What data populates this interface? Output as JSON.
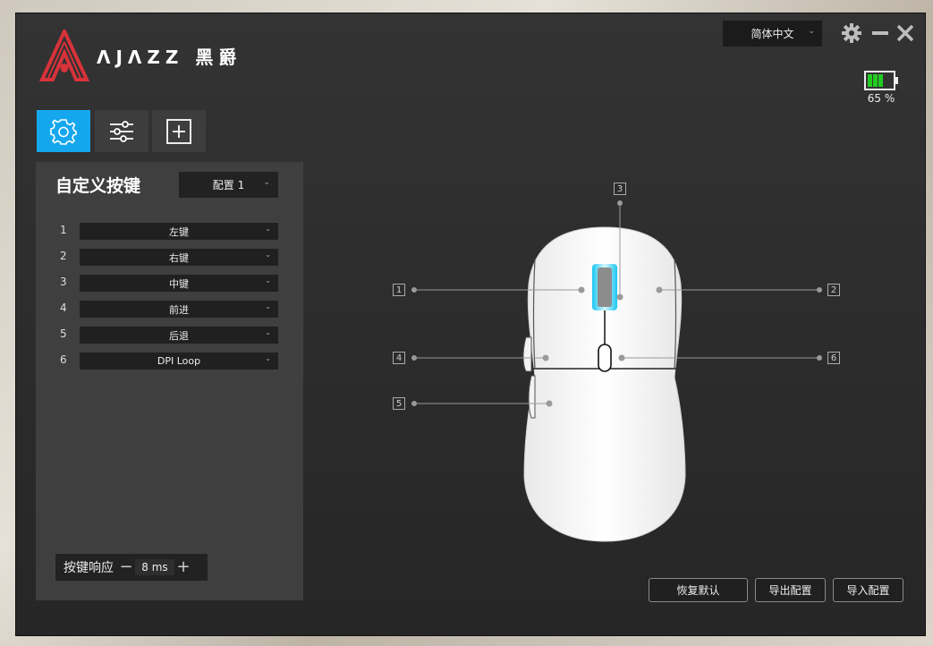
{
  "brand": {
    "name": "ΛJΛZZ 黑爵"
  },
  "header": {
    "language": "简体中文",
    "battery_percent": "65 %",
    "battery_level": 0.65,
    "battery_color": "#22cc22"
  },
  "tabs": [
    {
      "icon": "gear-icon",
      "active": true
    },
    {
      "icon": "sliders-icon",
      "active": false
    },
    {
      "icon": "macro-plus-icon",
      "active": false
    }
  ],
  "panel": {
    "title": "自定义按键",
    "profile": "配置 1",
    "buttons": [
      {
        "num": "1",
        "value": "左键"
      },
      {
        "num": "2",
        "value": "右键"
      },
      {
        "num": "3",
        "value": "中键"
      },
      {
        "num": "4",
        "value": "前进"
      },
      {
        "num": "5",
        "value": "后退"
      },
      {
        "num": "6",
        "value": "DPI Loop"
      }
    ],
    "response": {
      "label": "按键响应",
      "value": "8 ms"
    }
  },
  "callouts": [
    "1",
    "2",
    "3",
    "4",
    "5",
    "6"
  ],
  "actions": {
    "restore": "恢复默认",
    "export": "导出配置",
    "import": "导入配置"
  },
  "colors": {
    "accent": "#15a7ee",
    "logo": "#d8323a"
  }
}
